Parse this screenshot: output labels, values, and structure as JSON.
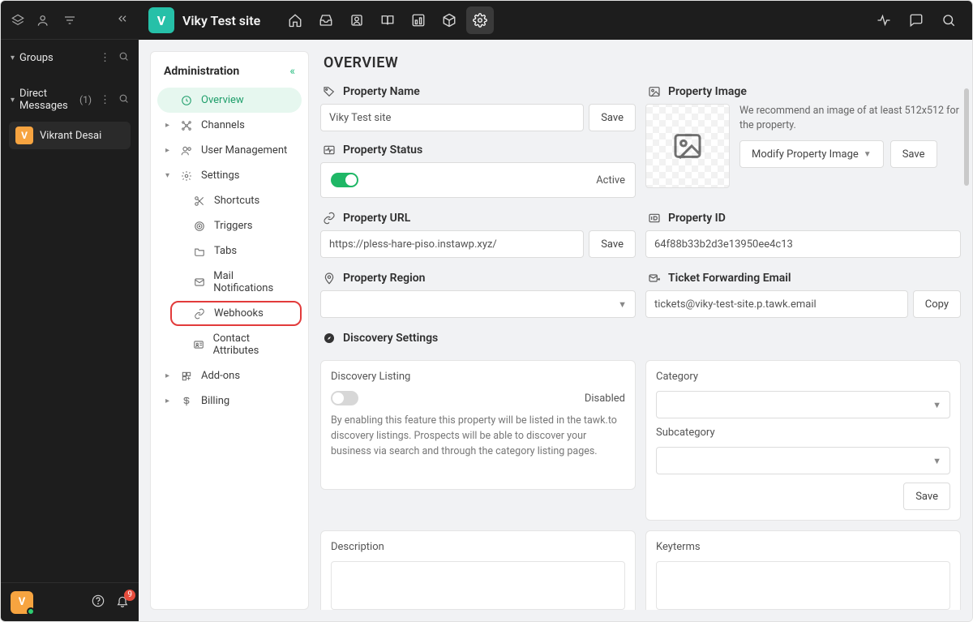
{
  "leftbar": {
    "groups_label": "Groups",
    "dm_label": "Direct Messages",
    "dm_count": "(1)",
    "dm_items": [
      {
        "initial": "V",
        "name": "Vikrant Desai"
      }
    ],
    "avatar_initial": "V",
    "bell_badge": "9"
  },
  "topbar": {
    "site_initial": "V",
    "site_name": "Viky Test site"
  },
  "admin_nav": {
    "title": "Administration",
    "items": {
      "overview": "Overview",
      "channels": "Channels",
      "user_mgmt": "User Management",
      "settings": "Settings",
      "shortcuts": "Shortcuts",
      "triggers": "Triggers",
      "tabs": "Tabs",
      "mail": "Mail Notifications",
      "webhooks": "Webhooks",
      "contact_attr": "Contact Attributes",
      "addons": "Add-ons",
      "billing": "Billing"
    }
  },
  "page": {
    "heading": "OVERVIEW",
    "prop_name_label": "Property Name",
    "prop_name_value": "Viky Test site",
    "save_btn": "Save",
    "prop_status_label": "Property Status",
    "prop_status_value": "Active",
    "prop_url_label": "Property URL",
    "prop_url_value": "https://pless-hare-piso.instawp.xyz/",
    "prop_region_label": "Property Region",
    "prop_image_label": "Property Image",
    "prop_image_rec": "We recommend an image of at least 512x512 for the property.",
    "modify_image_btn": "Modify Property Image",
    "prop_id_label": "Property ID",
    "prop_id_value": "64f88b33b2d3e13950ee4c13",
    "ticket_email_label": "Ticket Forwarding Email",
    "ticket_email_value": "tickets@viky-test-site.p.tawk.email",
    "copy_btn": "Copy",
    "discovery_heading": "Discovery Settings",
    "discovery_listing_label": "Discovery Listing",
    "discovery_listing_status": "Disabled",
    "discovery_desc": "By enabling this feature this property will be listed in the tawk.to discovery listings. Prospects will be able to discover your business via search and through the category listing pages.",
    "category_label": "Category",
    "subcategory_label": "Subcategory",
    "description_label": "Description",
    "keyterms_label": "Keyterms"
  }
}
